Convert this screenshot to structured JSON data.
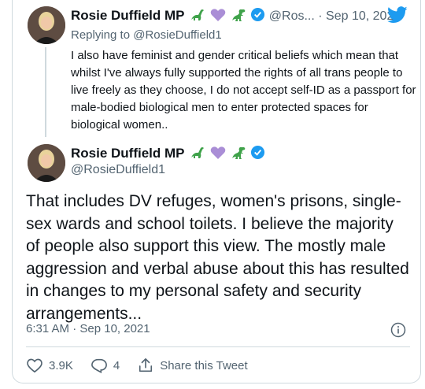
{
  "tweet1": {
    "name": "Rosie Duffield MP",
    "handle": "@Ros...",
    "separator": "·",
    "date": "Sep 10, 2021",
    "reply_prefix": "Replying to",
    "reply_handle": "@RosieDuffield1",
    "text": "I also have feminist and gender critical beliefs which mean that whilst I've always fully supported the rights of all trans people to live freely as they choose, I do not accept self-ID as a passport for male-bodied biological biological men to enter protected spaces for biological women.."
  },
  "tweet2": {
    "name": "Rosie Duffield MP",
    "handle": "@RosieDuffield1",
    "text": "That includes DV refuges, women's prisons, single-sex wards and school toilets. I believe the majority of people also support this view. The mostly male aggression and verbal abuse about this has resulted in changes to my personal safety and security arrangements...",
    "timestamp": "6:31 AM · Sep 10, 2021"
  },
  "actions": {
    "likes": "3.9K",
    "replies": "4",
    "share_label": "Share this Tweet"
  },
  "colors": {
    "twitter_blue": "#1d9bf0",
    "secondary_text": "#536471",
    "dino_green": "#3fa24a",
    "heart_purple": "#aa8ed6"
  },
  "icons": [
    "sauropod-emoji",
    "purple-heart-emoji",
    "t-rex-emoji",
    "verified-badge-icon",
    "twitter-bird-icon",
    "info-icon",
    "heart-icon",
    "reply-icon",
    "share-icon"
  ]
}
